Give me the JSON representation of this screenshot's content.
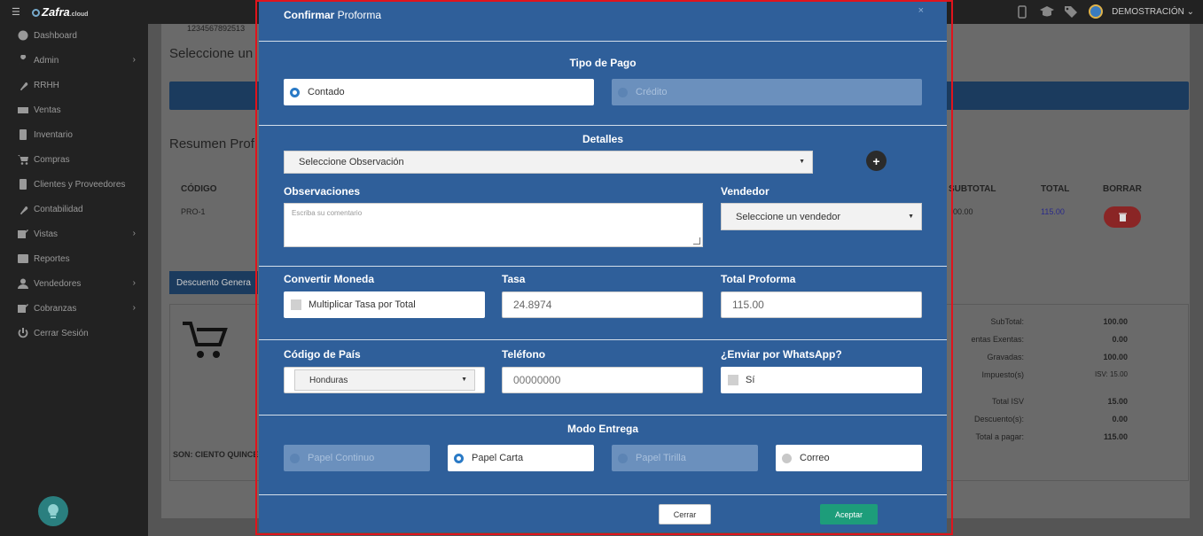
{
  "app": {
    "brand": "Zafra",
    "brand_suffix": ".cloud"
  },
  "topbar": {
    "user_name": "DEMOSTRACIÓN"
  },
  "sidebar": {
    "items": [
      {
        "label": "Dashboard",
        "icon": "dashboard-icon",
        "has_children": false
      },
      {
        "label": "Admin",
        "icon": "wrench-icon",
        "has_children": true
      },
      {
        "label": "RRHH",
        "icon": "paperclip-icon",
        "has_children": false
      },
      {
        "label": "Ventas",
        "icon": "money-icon",
        "has_children": false
      },
      {
        "label": "Inventario",
        "icon": "book-icon",
        "has_children": false
      },
      {
        "label": "Compras",
        "icon": "cart-icon",
        "has_children": false
      },
      {
        "label": "Clientes y Proveedores",
        "icon": "book-icon",
        "has_children": false
      },
      {
        "label": "Contabilidad",
        "icon": "paperclip-icon",
        "has_children": false
      },
      {
        "label": "Vistas",
        "icon": "edit-icon",
        "has_children": true
      },
      {
        "label": "Reportes",
        "icon": "list-icon",
        "has_children": false
      },
      {
        "label": "Vendedores",
        "icon": "user-icon",
        "has_children": true
      },
      {
        "label": "Cobranzas",
        "icon": "edit-icon",
        "has_children": true
      },
      {
        "label": "Cerrar Sesión",
        "icon": "power-icon",
        "has_children": false
      }
    ]
  },
  "background": {
    "id_number": "1234567892513",
    "select_heading": "Seleccione un",
    "summary_heading": "Resumen Prof",
    "table_headers": {
      "codigo": "CÓDIGO",
      "subtotal": "SUBTOTAL",
      "total": "TOTAL",
      "borrar": "BORRAR"
    },
    "row": {
      "codigo": "PRO-1",
      "subtotal": "00.00",
      "total": "115.00"
    },
    "descuento_button": "Descuento Genera",
    "son_text": "SON: CIENTO QUINCE",
    "summary": [
      {
        "label": "SubTotal:",
        "value": "100.00"
      },
      {
        "label": "entas Exentas:",
        "value": "0.00"
      },
      {
        "label": "Gravadas:",
        "value": "100.00"
      },
      {
        "label": "Impuesto(s)",
        "value": "ISV: 15.00"
      },
      {
        "label": "Total ISV",
        "value": "15.00"
      },
      {
        "label": "Descuento(s):",
        "value": "0.00"
      },
      {
        "label": "Total a pagar:",
        "value": "115.00"
      }
    ]
  },
  "modal": {
    "title_bold": "Confirmar",
    "title_rest": " Proforma",
    "close": "×",
    "tipo_pago": {
      "heading": "Tipo de Pago",
      "options": [
        {
          "label": "Contado",
          "selected": true
        },
        {
          "label": "Crédito",
          "selected": false
        }
      ]
    },
    "detalles": {
      "heading": "Detalles",
      "observacion_select": "Seleccione Observación",
      "observaciones_label": "Observaciones",
      "observaciones_placeholder": "Escriba su comentario",
      "vendedor_label": "Vendedor",
      "vendedor_select": "Seleccione un vendedor"
    },
    "moneda": {
      "convertir_label": "Convertir Moneda",
      "multiplicar_label": "Multiplicar Tasa por Total",
      "tasa_label": "Tasa",
      "tasa_value": "24.8974",
      "total_label": "Total Proforma",
      "total_value": "115.00"
    },
    "contacto": {
      "pais_label": "Código de País",
      "pais_value": "Honduras",
      "telefono_label": "Teléfono",
      "telefono_placeholder": "00000000",
      "whatsapp_label": "¿Enviar por WhatsApp?",
      "whatsapp_option": "Sí"
    },
    "entrega": {
      "heading": "Modo Entrega",
      "options": [
        {
          "label": "Papel Continuo",
          "state": "disabled"
        },
        {
          "label": "Papel Carta",
          "state": "selected"
        },
        {
          "label": "Papel Tirilla",
          "state": "disabled"
        },
        {
          "label": "Correo",
          "state": "available"
        }
      ]
    },
    "buttons": {
      "cerrar": "Cerrar",
      "aceptar": "Aceptar"
    }
  },
  "colors": {
    "modal_bg": "#2f5f9a",
    "accept": "#1d9d7a",
    "highlight_border": "#e0141d"
  }
}
